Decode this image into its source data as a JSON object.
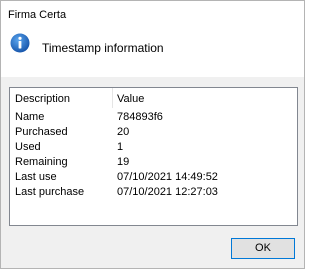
{
  "window": {
    "title": "Firma Certa"
  },
  "header": {
    "icon": "info-icon",
    "text": "Timestamp information",
    "icon_color": "#1f6fc5"
  },
  "list": {
    "columns": [
      "Description",
      "Value"
    ],
    "rows": [
      {
        "description": "Name",
        "value": "784893f6"
      },
      {
        "description": "Purchased",
        "value": "20"
      },
      {
        "description": "Used",
        "value": "1"
      },
      {
        "description": "Remaining",
        "value": "19"
      },
      {
        "description": "Last use",
        "value": "07/10/2021 14:49:52"
      },
      {
        "description": "Last purchase",
        "value": "07/10/2021 12:27:03"
      }
    ]
  },
  "footer": {
    "ok_label": "OK"
  }
}
